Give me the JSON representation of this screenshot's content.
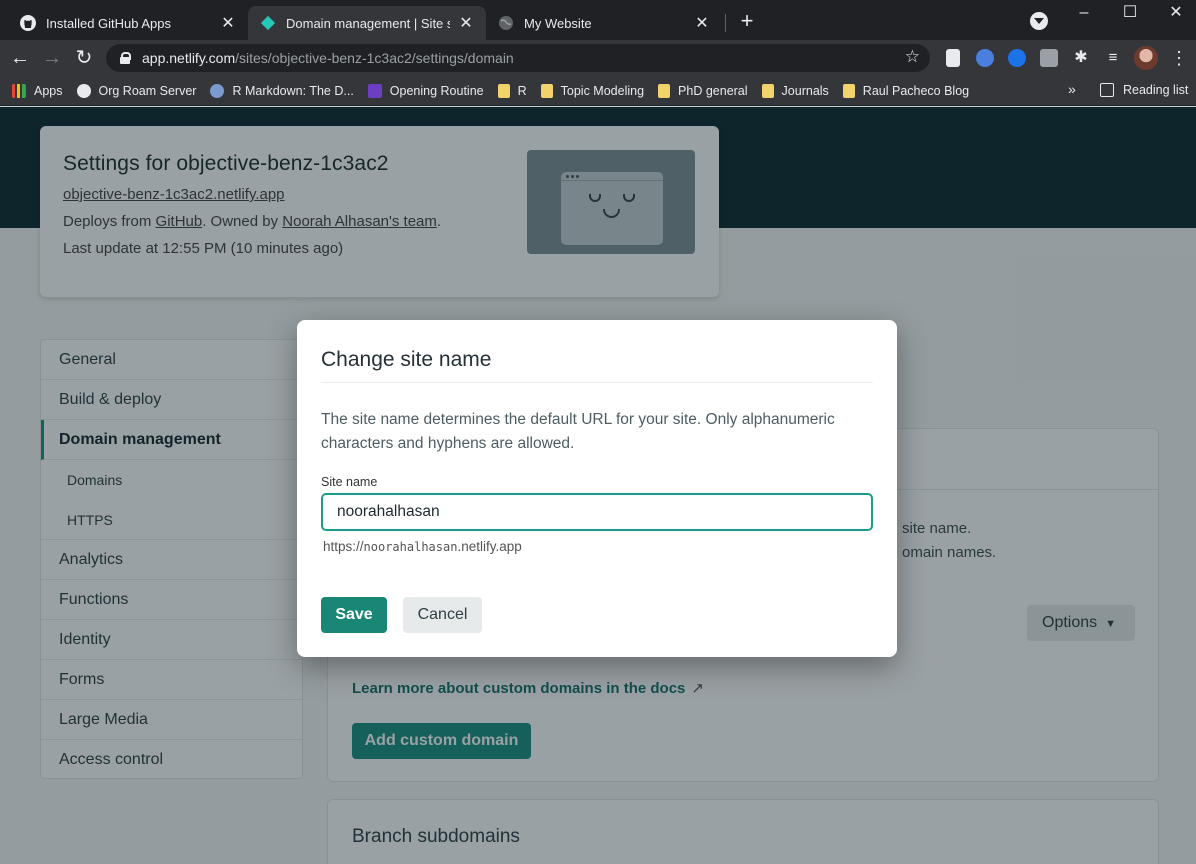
{
  "browser": {
    "tabs": [
      {
        "title": "Installed GitHub Apps",
        "icon": "github-icon"
      },
      {
        "title": "Domain management | Site settings",
        "icon": "netlify-icon",
        "active": true
      },
      {
        "title": "My Website",
        "icon": "globe-icon"
      }
    ],
    "url_host": "app.netlify.com",
    "url_path": "/sites/objective-benz-1c3ac2/settings/domain",
    "bookmarks": [
      {
        "label": "Apps",
        "icon": "apps-grid-icon"
      },
      {
        "label": "Org Roam Server",
        "icon": "globe-icon"
      },
      {
        "label": "R Markdown: The D...",
        "icon": "r-icon"
      },
      {
        "label": "Opening Routine",
        "icon": "list-icon"
      },
      {
        "label": "R",
        "icon": "folder-icon"
      },
      {
        "label": "Topic Modeling",
        "icon": "folder-icon"
      },
      {
        "label": "PhD general",
        "icon": "folder-icon"
      },
      {
        "label": "Journals",
        "icon": "folder-icon"
      },
      {
        "label": "Raul Pacheco Blog",
        "icon": "folder-icon"
      }
    ],
    "bookmarks_more": "»",
    "reading_list": "Reading list"
  },
  "site": {
    "title": "Settings for objective-benz-1c3ac2",
    "url": "objective-benz-1c3ac2.netlify.app",
    "deploys_prefix": "Deploys from ",
    "deploys_source": "GitHub",
    "owned_prefix": ". Owned by ",
    "owner": "Noorah Alhasan's team",
    "owned_suffix": ".",
    "last_update": "Last update at 12:55 PM (10 minutes ago)"
  },
  "sidebar": {
    "items": [
      {
        "label": "General"
      },
      {
        "label": "Build & deploy"
      },
      {
        "label": "Domain management",
        "active": true
      },
      {
        "label": "Domains",
        "sub": true
      },
      {
        "label": "HTTPS",
        "sub": true
      },
      {
        "label": "Analytics"
      },
      {
        "label": "Functions"
      },
      {
        "label": "Identity"
      },
      {
        "label": "Forms"
      },
      {
        "label": "Large Media"
      },
      {
        "label": "Access control"
      }
    ]
  },
  "panel": {
    "text_line1": "site name.",
    "text_line2": "omain names.",
    "options_label": "Options",
    "learn_link": "Learn more about custom domains in the docs",
    "learn_arrow": "↗",
    "add_domain_label": "Add custom domain",
    "branch_title": "Branch subdomains"
  },
  "modal": {
    "title": "Change site name",
    "description": "The site name determines the default URL for your site. Only alphanumeric characters and hyphens are allowed.",
    "field_label": "Site name",
    "field_value": "noorahalhasan",
    "preview_prefix": "https://",
    "preview_name": "noorahalhasan",
    "preview_suffix": ".netlify.app",
    "save_label": "Save",
    "cancel_label": "Cancel"
  },
  "colors": {
    "accent": "#1a8f80",
    "hero": "#0d2a30"
  }
}
